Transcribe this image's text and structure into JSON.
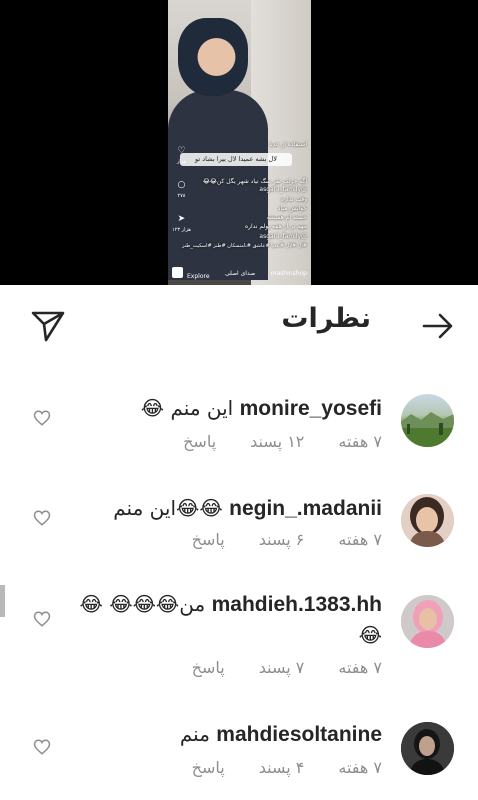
{
  "media": {
    "caption_bubble": "لال بشه عمیدا لال بیرا بشاد تو",
    "overlay_lines": [
      "استفاده از عدیا",
      "اگه جرئت نفر سگ نیاد شهر یگل کن😂😂",
      "@asgarii_family",
      "وقت نداره",
      "خوابش میاد",
      "خسته ام همیشه",
      "مهم تر از همه پولم نداره",
      "@asgarii_family",
      "#ال #لال #عدیا #عاشق #نامتسکان #طنز #اسکیت_طنز"
    ],
    "side_counts": [
      "هزار",
      "۲۷۸",
      "۱۲۳ هزار"
    ],
    "explore_label": "Explore",
    "audio_label": "صدای اصلی",
    "handle_label": "mashinshop"
  },
  "header": {
    "title": "نظرات"
  },
  "comments": [
    {
      "username": "monire_yosefi",
      "text": "این منم 😂",
      "time": "۷ هفته",
      "likes": "۱۲ پسند",
      "reply": "پاسخ",
      "avatar": "landscape-avatar"
    },
    {
      "username": "negin_.madanii",
      "text": "😂😂این منم",
      "time": "۷ هفته",
      "likes": "۶ پسند",
      "reply": "پاسخ",
      "avatar": "woman-avatar"
    },
    {
      "username": "mahdieh.1383.hh",
      "text": "من😂😂😂 😂😂",
      "time": "۷ هفته",
      "likes": "۷ پسند",
      "reply": "پاسخ",
      "avatar": "girl-pink-avatar"
    },
    {
      "username": "mahdiesoltanine",
      "text": "منم",
      "time": "۷ هفته",
      "likes": "۴ پسند",
      "reply": "پاسخ",
      "avatar": "woman-dark-avatar"
    }
  ]
}
